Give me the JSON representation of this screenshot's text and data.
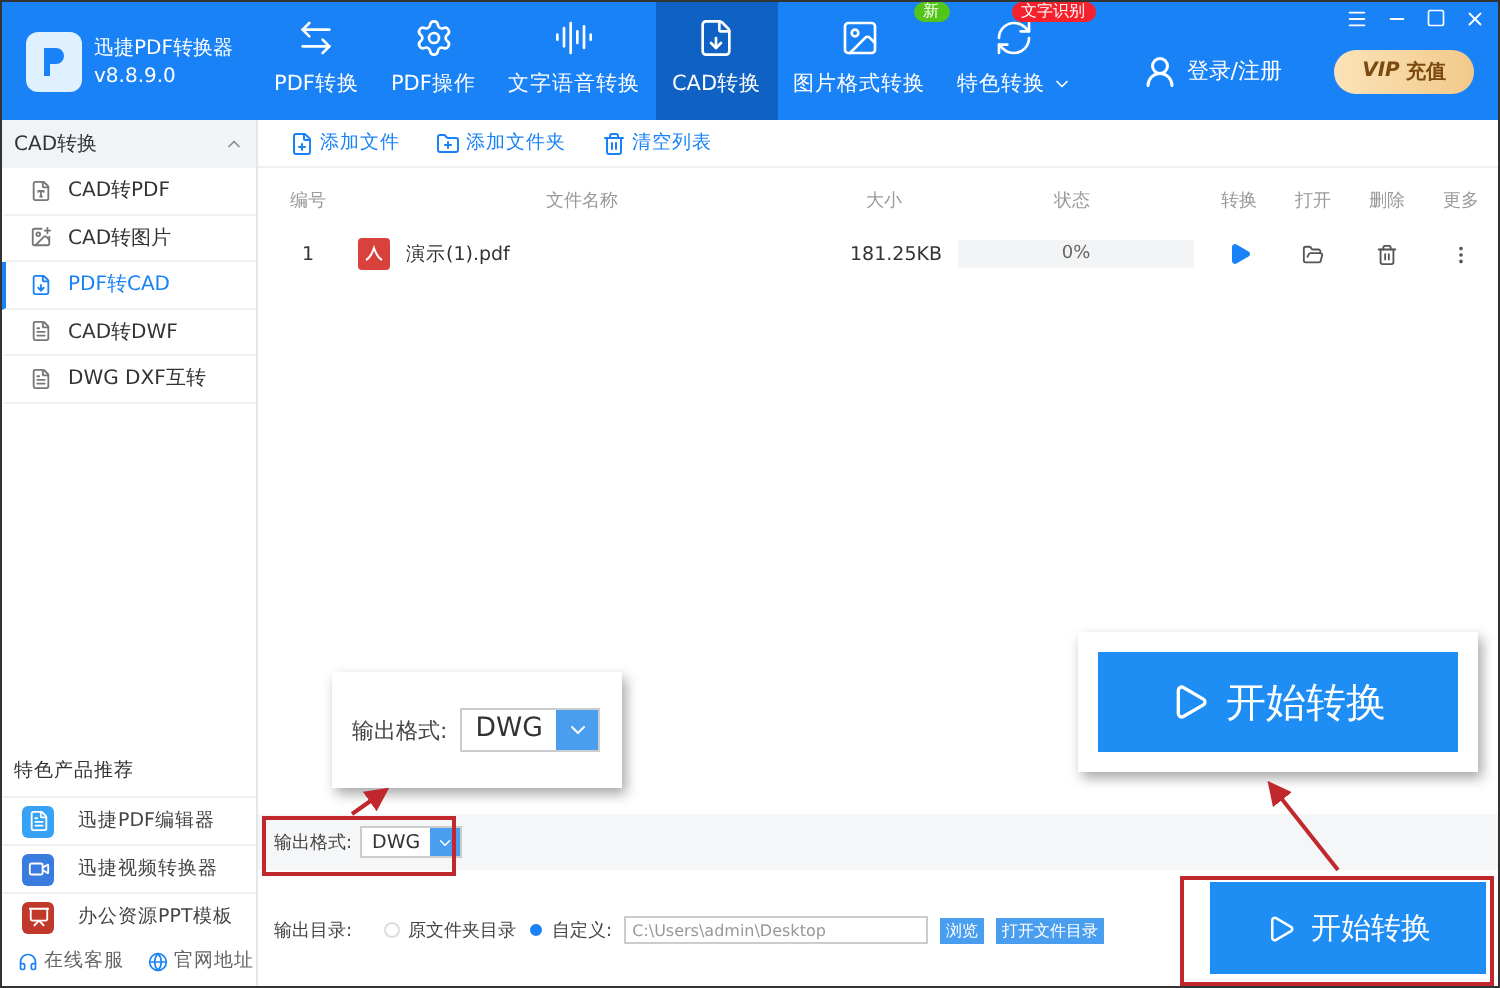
{
  "app": {
    "name": "迅捷PDF转换器",
    "version": "v8.8.9.0"
  },
  "nav": [
    {
      "label": "PDF转换",
      "selected": false
    },
    {
      "label": "PDF操作",
      "selected": false
    },
    {
      "label": "文字语音转换",
      "selected": false
    },
    {
      "label": "CAD转换",
      "selected": true
    },
    {
      "label": "图片格式转换",
      "selected": false,
      "badge": "新"
    },
    {
      "label": "特色转换",
      "selected": false,
      "badge": "文字识别",
      "dropdown": true
    }
  ],
  "login": "登录/注册",
  "vip": {
    "tag": "VIP",
    "label": "充值"
  },
  "sidebar": {
    "title": "CAD转换",
    "expanded": true,
    "items": [
      {
        "label": "CAD转PDF",
        "selected": false
      },
      {
        "label": "CAD转图片",
        "selected": false
      },
      {
        "label": "PDF转CAD",
        "selected": true
      },
      {
        "label": "CAD转DWF",
        "selected": false
      },
      {
        "label": "DWG DXF互转",
        "selected": false
      }
    ],
    "featured_title": "特色产品推荐",
    "featured": [
      {
        "label": "迅捷PDF编辑器",
        "kind": "pdf"
      },
      {
        "label": "迅捷视频转换器",
        "kind": "video"
      },
      {
        "label": "办公资源PPT模板",
        "kind": "ppt"
      }
    ],
    "links": [
      {
        "label": "在线客服",
        "kind": "service"
      },
      {
        "label": "官网地址",
        "kind": "web"
      }
    ]
  },
  "toolbar": [
    {
      "label": "添加文件",
      "kind": "file"
    },
    {
      "label": "添加文件夹",
      "kind": "folder"
    },
    {
      "label": "清空列表",
      "kind": "clear"
    }
  ],
  "table": {
    "columns": [
      "编号",
      "文件名称",
      "大小",
      "状态",
      "转换",
      "打开",
      "删除",
      "更多"
    ],
    "rows": [
      {
        "index": "1",
        "name": "演示(1).pdf",
        "size": "181.25KB",
        "status": "0%",
        "level": 0
      }
    ]
  },
  "output_format": {
    "label": "输出格式:",
    "value": "DWG"
  },
  "output_dir": {
    "label": "输出目录:",
    "options": [
      {
        "label": "原文件夹目录",
        "selected": false
      },
      {
        "label": "自定义:",
        "selected": true
      }
    ],
    "path": "C:\\Users\\admin\\Desktop",
    "browse": "浏览",
    "open": "打开文件目录"
  },
  "start_button": "开始转换",
  "callouts": [
    {
      "kind": "format",
      "label": "输出格式:",
      "value": "DWG"
    },
    {
      "kind": "button",
      "label": "开始转换"
    }
  ]
}
